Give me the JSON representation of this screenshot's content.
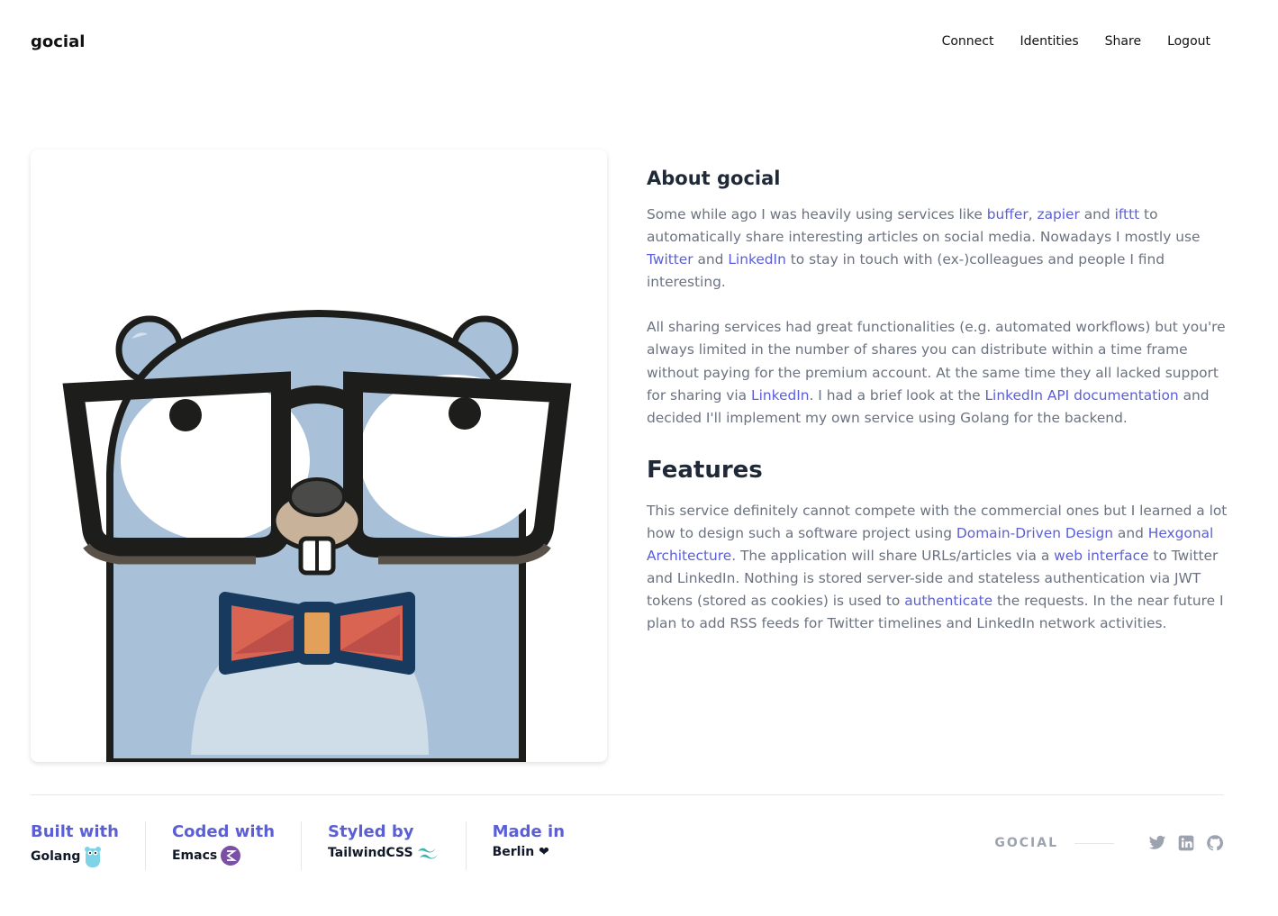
{
  "header": {
    "brand": "gocial",
    "nav": [
      "Connect",
      "Identities",
      "Share",
      "Logout"
    ]
  },
  "about": {
    "title": "About gocial",
    "p1": {
      "t1": "Some while ago I was heavily using services like ",
      "l1": "buffer",
      "t2": ", ",
      "l2": "zapier",
      "t3": " and ",
      "l3": "ifttt",
      "t4": " to automatically share interesting articles on social media. Nowadays I mostly use ",
      "l4": "Twitter",
      "t5": " and ",
      "l5": "LinkedIn",
      "t6": " to stay in touch with (ex-)colleagues and people I find interesting."
    },
    "p2": {
      "t1": "All sharing services had great functionalities (e.g. automated workflows) but you're always limited in the number of shares you can distribute within a time frame without paying for the premium account. At the same time they all lacked support for sharing via ",
      "l1": "LinkedIn",
      "t2": ". I had a brief look at the ",
      "l2": "LinkedIn API documentation",
      "t3": " and decided I'll implement my own service using Golang for the backend."
    }
  },
  "features": {
    "title": "Features",
    "p1": {
      "t1": "This service definitely cannot compete with the commercial ones but I learned a lot how to design such a software project using ",
      "l1": "Domain-Driven Design",
      "t2": " and ",
      "l2": "Hexgonal Architecture",
      "t3": ". The application will share URLs/articles via a ",
      "l3": "web interface",
      "t4": " to Twitter and LinkedIn. Nothing is stored server-side and stateless authentication via JWT tokens (stored as cookies) is used to ",
      "l4": "authenticate",
      "t5": " the requests. In the near future I plan to add RSS feeds for Twitter timelines and LinkedIn network activities."
    }
  },
  "footer": {
    "credits": [
      {
        "title": "Built with",
        "value": "Golang",
        "icon": "gopher-icon"
      },
      {
        "title": "Coded with",
        "value": "Emacs",
        "icon": "emacs-icon"
      },
      {
        "title": "Styled by",
        "value": "TailwindCSS",
        "icon": "tailwind-icon"
      },
      {
        "title": "Made in",
        "value": "Berlin ❤",
        "icon": ""
      }
    ],
    "brand": "GOCIAL",
    "social": [
      "twitter-icon",
      "linkedin-icon",
      "github-icon"
    ]
  },
  "colors": {
    "accent": "#5b5fd6",
    "muted_text": "#6b7280",
    "heading": "#1f2937",
    "gopher_body": "#a8c1d8"
  }
}
